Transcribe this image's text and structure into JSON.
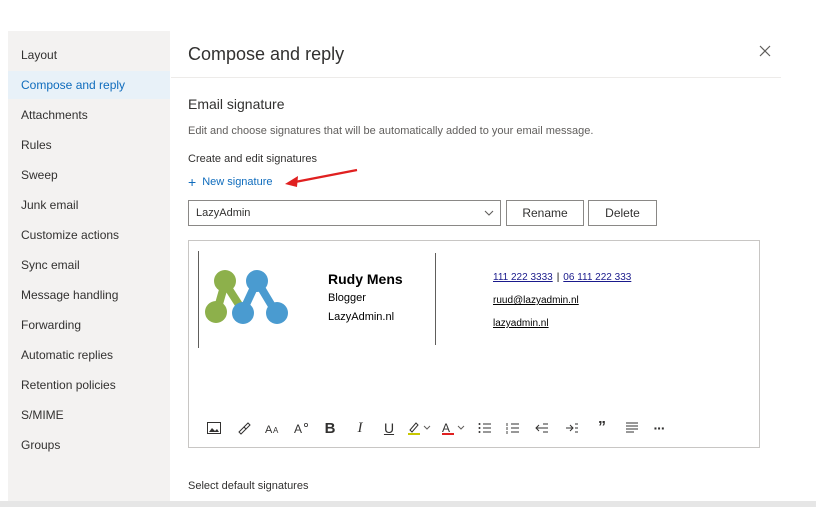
{
  "sidebar": {
    "items": [
      {
        "label": "Layout",
        "active": false
      },
      {
        "label": "Compose and reply",
        "active": true
      },
      {
        "label": "Attachments",
        "active": false
      },
      {
        "label": "Rules",
        "active": false
      },
      {
        "label": "Sweep",
        "active": false
      },
      {
        "label": "Junk email",
        "active": false
      },
      {
        "label": "Customize actions",
        "active": false
      },
      {
        "label": "Sync email",
        "active": false
      },
      {
        "label": "Message handling",
        "active": false
      },
      {
        "label": "Forwarding",
        "active": false
      },
      {
        "label": "Automatic replies",
        "active": false
      },
      {
        "label": "Retention policies",
        "active": false
      },
      {
        "label": "S/MIME",
        "active": false
      },
      {
        "label": "Groups",
        "active": false
      }
    ]
  },
  "header": {
    "title": "Compose and reply",
    "close_icon": "close-icon"
  },
  "email_signature": {
    "title": "Email signature",
    "description": "Edit and choose signatures that will be automatically added to your email message.",
    "create_edit_title": "Create and edit signatures",
    "new_signature_label": "New signature",
    "selected_signature": "LazyAdmin",
    "rename_label": "Rename",
    "delete_label": "Delete"
  },
  "signature_content": {
    "name": "Rudy Mens",
    "role": "Blogger",
    "site": "LazyAdmin.nl",
    "phone1": "111 222 3333",
    "separator": "|",
    "phone2": "06 111 222 333",
    "email": "ruud@lazyadmin.nl",
    "web": "lazyadmin.nl"
  },
  "toolbar": {
    "icons": [
      "insert-image-icon",
      "format-painter-icon",
      "font-size-icon",
      "font-grow-icon",
      "bold-icon",
      "italic-icon",
      "underline-icon",
      "highlight-icon",
      "font-color-icon",
      "bullets-icon",
      "numbering-icon",
      "decrease-indent-icon",
      "increase-indent-icon",
      "quote-icon",
      "align-icon",
      "more-icon"
    ],
    "bold": "B",
    "italic": "I",
    "underline": "U",
    "quote": "”",
    "more": "···"
  },
  "default_signatures": {
    "title": "Select default signatures"
  },
  "colors": {
    "accent": "#0f6cbd",
    "arrow": "#e02020",
    "logo_green": "#8db04b",
    "logo_blue": "#4a9bd0"
  }
}
